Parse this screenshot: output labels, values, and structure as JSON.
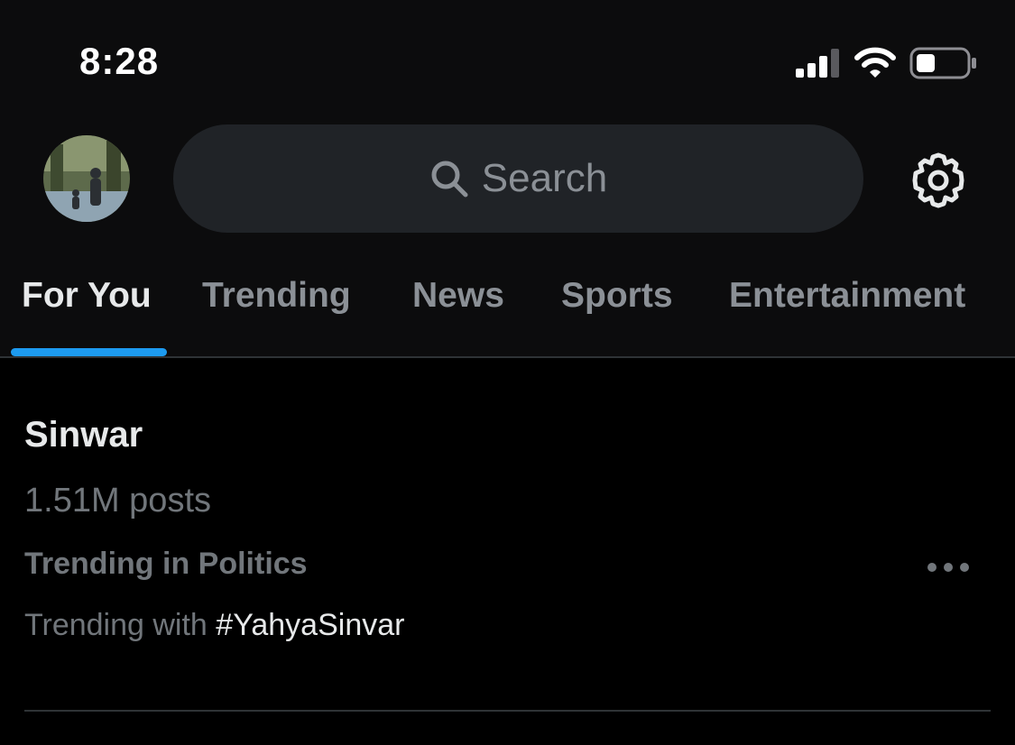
{
  "status_bar": {
    "time": "8:28",
    "icons": [
      "cellular-signal-icon",
      "wifi-icon",
      "battery-icon"
    ]
  },
  "header": {
    "avatar": "profile-avatar",
    "search": {
      "placeholder": "Search",
      "icon": "search-icon"
    },
    "settings_icon": "gear-icon"
  },
  "tabs": [
    {
      "label": "For You",
      "active": true
    },
    {
      "label": "Trending",
      "active": false
    },
    {
      "label": "News",
      "active": false
    },
    {
      "label": "Sports",
      "active": false
    },
    {
      "label": "Entertainment",
      "active": false
    }
  ],
  "trends": [
    {
      "title": "Sinwar",
      "posts": "1.51M posts",
      "category": "Trending in Politics",
      "with_prefix": "Trending with",
      "with_hashtag": "#YahyaSinvar",
      "more_icon": "more-options-icon"
    }
  ],
  "colors": {
    "background": "#000000",
    "header_background": "#0c0c0d",
    "search_background": "#202327",
    "accent": "#1d9bf0",
    "primary_text": "#e7e9ea",
    "secondary_text": "#71767b",
    "divider": "#2f3336"
  }
}
